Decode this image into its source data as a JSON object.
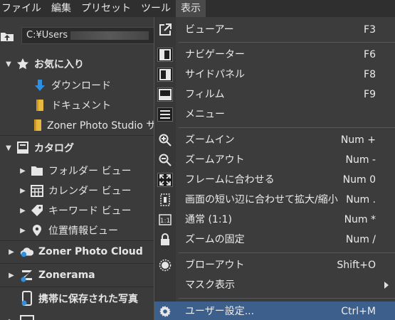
{
  "menubar": {
    "items": [
      "ファイル",
      "編集",
      "プリセット",
      "ツール",
      "表示"
    ]
  },
  "left_panel": {
    "path_text": "C:¥Users",
    "favorites": {
      "label": "お気に入り",
      "items": [
        "ダウンロード",
        "ドキュメント",
        "Zoner Photo Studio サ"
      ]
    },
    "catalog": {
      "label": "カタログ",
      "items": [
        "フォルダー ビュー",
        "カレンダー ビュー",
        "キーワード ビュー",
        "位置情報ビュー"
      ]
    },
    "cloud_label": "Zoner Photo Cloud",
    "zonerama_label": "Zonerama",
    "mobile_label": "携帯に保存された写真"
  },
  "view_menu": {
    "items": [
      {
        "label": "ビューアー",
        "shortcut": "F3",
        "icon": "viewer-icon"
      },
      {
        "label": "ナビゲーター",
        "shortcut": "F6",
        "icon": "navigator-panel-icon"
      },
      {
        "label": "サイドパネル",
        "shortcut": "F8",
        "icon": "side-panel-icon"
      },
      {
        "label": "フィルム",
        "shortcut": "F9",
        "icon": "filmstrip-icon"
      },
      {
        "label": "メニュー",
        "shortcut": "",
        "icon": "menu-icon"
      },
      {
        "label": "ズームイン",
        "shortcut": "Num +",
        "icon": "zoom-in-icon"
      },
      {
        "label": "ズームアウト",
        "shortcut": "Num -",
        "icon": "zoom-out-icon"
      },
      {
        "label": "フレームに合わせる",
        "shortcut": "Num 0",
        "icon": "fit-frame-icon"
      },
      {
        "label": "画面の短い辺に合わせて拡大/縮小",
        "shortcut": "Num .",
        "icon": "fit-short-side-icon"
      },
      {
        "label": "通常 (1:1)",
        "shortcut": "Num *",
        "icon": "actual-size-icon"
      },
      {
        "label": "ズームの固定",
        "shortcut": "Num /",
        "icon": "lock-icon"
      },
      {
        "label": "ブローアウト",
        "shortcut": "Shift+O",
        "icon": "blowout-icon"
      },
      {
        "label": "マスク表示",
        "shortcut": "",
        "icon": ""
      },
      {
        "label": "ユーザー設定...",
        "shortcut": "Ctrl+M",
        "icon": "gear-icon"
      }
    ]
  },
  "colors": {
    "selection": "#3d5f8c",
    "accent_blue": "#2f8fe0",
    "folder_yellow": "#e8b93a"
  }
}
